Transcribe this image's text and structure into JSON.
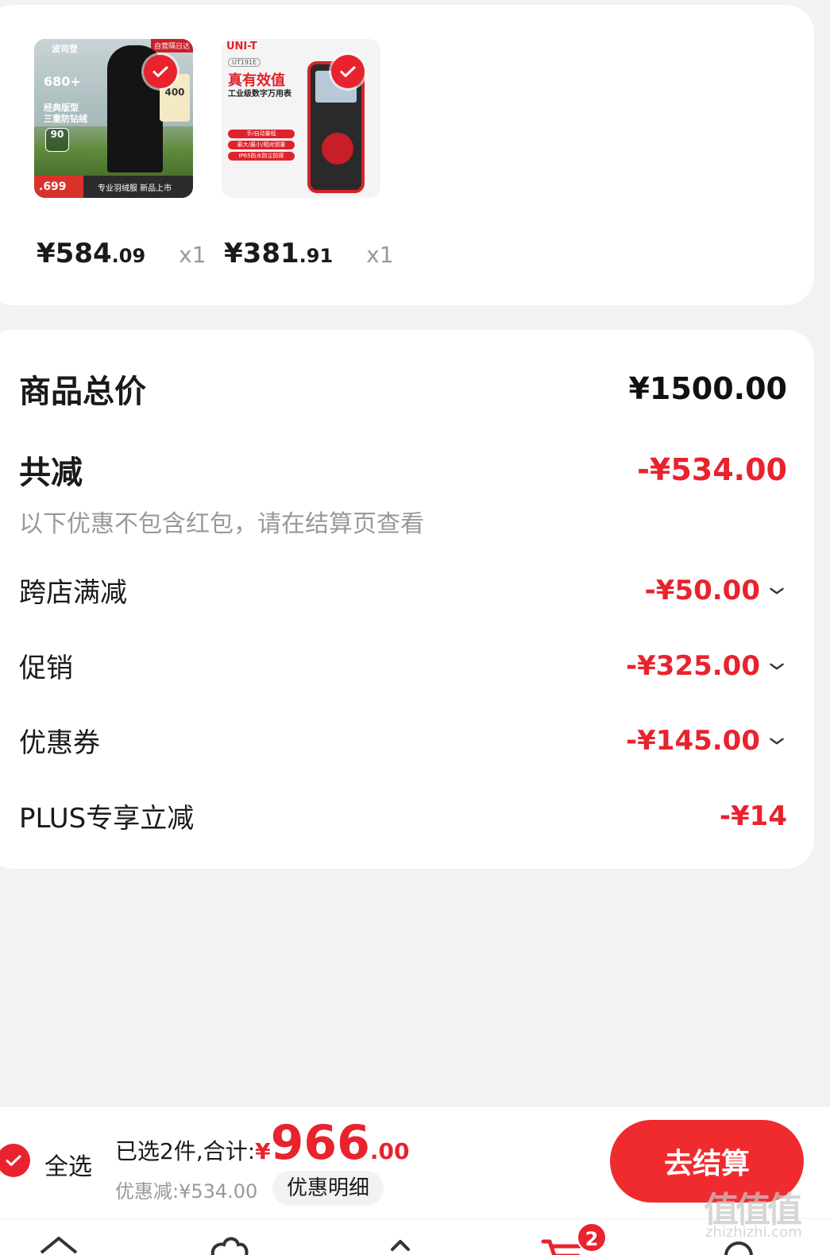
{
  "products": [
    {
      "price_int": "¥584",
      "price_dec": ".09",
      "qty": "x1",
      "thumb": {
        "brand": "波司登",
        "tag": "自营隔日达",
        "headline": "680+",
        "lines": [
          "经典版型",
          "三重防钻绒"
        ],
        "badge": "90",
        "panel_value": "400",
        "bottom_price": ".699",
        "bottom_text": "专业羽绒服 新品上市"
      }
    },
    {
      "price_int": "¥381",
      "price_dec": ".91",
      "qty": "x1",
      "thumb": {
        "logo": "UNI-T",
        "model": "UT191E",
        "title": "真有效值",
        "subtitle": "工业级数字万用表",
        "pills": [
          "手/自动量程",
          "最大/最小/相对测量",
          "IP65防水防尘防摔"
        ]
      }
    }
  ],
  "summary": {
    "total_label": "商品总价",
    "total_value": "¥1500.00",
    "reduce_label": "共减",
    "reduce_value": "-¥534.00",
    "note": "以下优惠不包含红包，请在结算页查看",
    "items": [
      {
        "label": "跨店满减",
        "value": "-¥50.00"
      },
      {
        "label": "促销",
        "value": "-¥325.00"
      },
      {
        "label": "优惠券",
        "value": "-¥145.00"
      },
      {
        "label": "PLUS专享立减",
        "value": "-¥14"
      }
    ]
  },
  "bottom_bar": {
    "select_all": "全选",
    "selected_text": "已选2件,合计:",
    "yen": "¥",
    "total_int": "966",
    "total_dec": ".00",
    "discount_text": "优惠减:¥534.00",
    "detail_button": "优惠明细",
    "checkout_button": "去结算"
  },
  "tab_bar": {
    "cart_badge": "2",
    "icons": [
      "home-icon",
      "cloud-icon",
      "code-icon",
      "cart-icon",
      "profile-icon"
    ]
  },
  "watermark": {
    "text": "值值值",
    "url": "zhizhizhi.com"
  },
  "colors": {
    "accent": "#e8232e",
    "button": "#ef2b2f",
    "muted": "#999999",
    "background": "#f2f2f2"
  }
}
